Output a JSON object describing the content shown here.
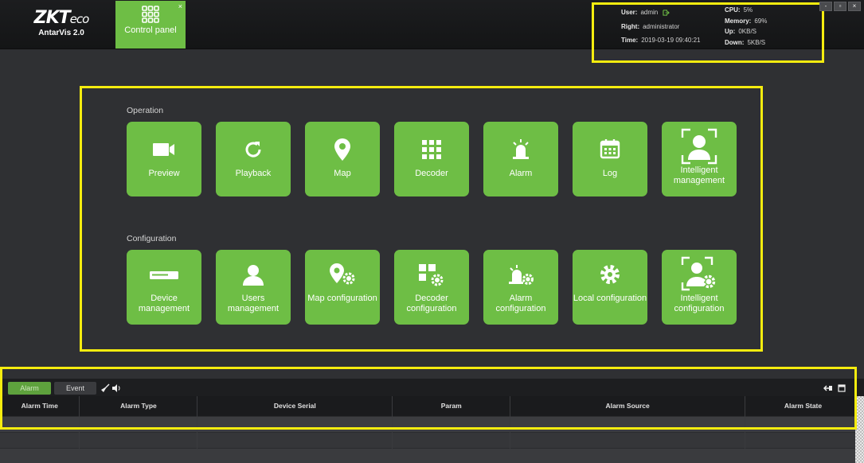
{
  "app": {
    "brand": "ZKTeco",
    "brand_main": "ZKT",
    "brand_tail": "eco",
    "product": "AntarVis 2.0"
  },
  "tabs": [
    {
      "label": "Control panel",
      "icon": "grid-icon",
      "active": true
    }
  ],
  "status": {
    "user_label": "User:",
    "user_value": "admin",
    "right_label": "Right:",
    "right_value": "administrator",
    "time_label": "Time:",
    "time_value": "2019-03-19 09:40:21",
    "cpu_label": "CPU:",
    "cpu_value": "5%",
    "memory_label": "Memory:",
    "memory_value": "69%",
    "up_label": "Up:",
    "up_value": "0KB/S",
    "down_label": "Down:",
    "down_value": "5KB/S"
  },
  "window_controls": [
    "-",
    "▫",
    "×"
  ],
  "operation": {
    "title": "Operation",
    "tiles": [
      {
        "label": "Preview",
        "icon": "camera-icon"
      },
      {
        "label": "Playback",
        "icon": "refresh-icon"
      },
      {
        "label": "Map",
        "icon": "map-pin-icon"
      },
      {
        "label": "Decoder",
        "icon": "grid-icon"
      },
      {
        "label": "Alarm",
        "icon": "siren-icon"
      },
      {
        "label": "Log",
        "icon": "calendar-icon"
      },
      {
        "label": "Intelligent management",
        "icon": "face-scan-icon"
      }
    ]
  },
  "configuration": {
    "title": "Configuration",
    "tiles": [
      {
        "label": "Device management",
        "icon": "device-icon"
      },
      {
        "label": "Users management",
        "icon": "user-icon"
      },
      {
        "label": "Map configuration",
        "icon": "map-gear-icon"
      },
      {
        "label": "Decoder configuration",
        "icon": "decoder-gear-icon"
      },
      {
        "label": "Alarm configuration",
        "icon": "alarm-gear-icon"
      },
      {
        "label": "Local configuration",
        "icon": "gear-icon"
      },
      {
        "label": "Intelligent configuration",
        "icon": "face-gear-icon"
      }
    ]
  },
  "bottom": {
    "tabs": [
      {
        "label": "Alarm",
        "active": true
      },
      {
        "label": "Event",
        "active": false
      }
    ],
    "columns": [
      "Alarm Time",
      "Alarm Type",
      "Device Serial",
      "Param",
      "Alarm Source",
      "Alarm State"
    ]
  },
  "colors": {
    "accent": "#6ebe45",
    "highlight_border": "#f5ec0f",
    "background": "#2f3033"
  }
}
